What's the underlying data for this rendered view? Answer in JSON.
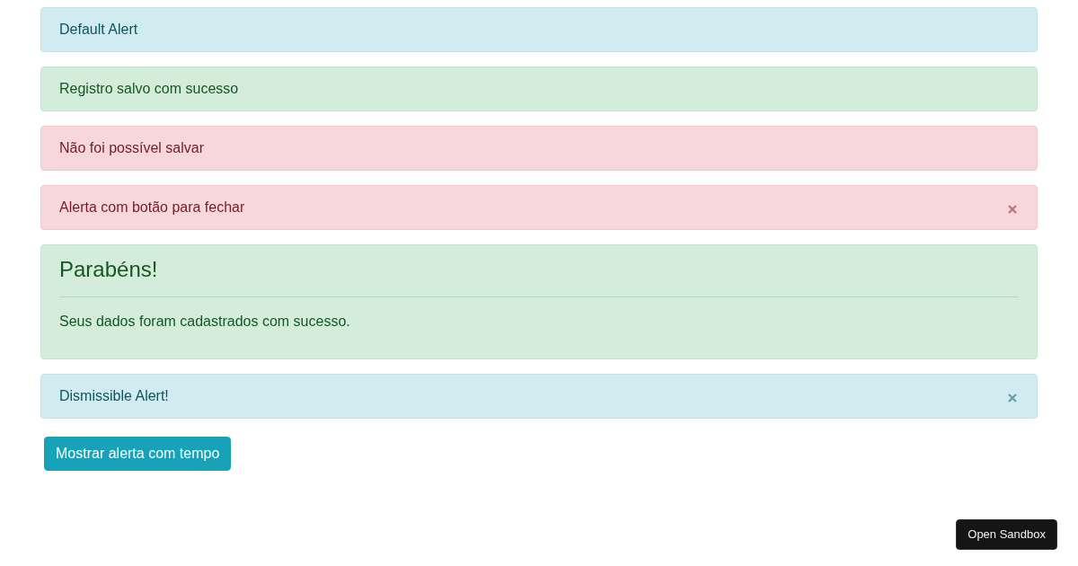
{
  "alerts": [
    {
      "kind": "plain",
      "color": "#d1ecf1",
      "text": "Default Alert",
      "dismissible": false
    },
    {
      "kind": "plain",
      "color": "#d4edda",
      "text": "Registro salvo com sucesso",
      "dismissible": false
    },
    {
      "kind": "plain",
      "color": "#f8d7da",
      "text": "Não foi possível salvar",
      "dismissible": false
    },
    {
      "kind": "plain",
      "color": "#f8d7da",
      "text": "Alerta com botão para fechar",
      "dismissible": true
    },
    {
      "kind": "heading",
      "color": "#d4edda",
      "heading": "Parabéns!",
      "text": "Seus dados foram cadastrados com sucesso.",
      "dismissible": false
    },
    {
      "kind": "plain",
      "color": "#d1ecf1",
      "text": "Dismissible Alert!",
      "dismissible": true
    }
  ],
  "timed_alert_button": {
    "label": "Mostrar alerta com tempo"
  },
  "sandbox_button": {
    "label": "Open Sandbox"
  }
}
